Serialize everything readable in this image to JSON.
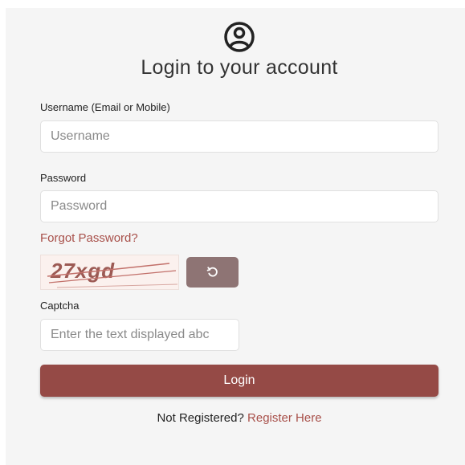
{
  "form": {
    "title": "Login to your account",
    "icon": "user-circle-icon",
    "username_label": "Username (Email or Mobile)",
    "username_placeholder": "Username",
    "username_value": "",
    "password_label": "Password",
    "password_placeholder": "Password",
    "password_value": "",
    "forgot_password": "Forgot Password?",
    "captcha_image_text": "27xgd",
    "refresh_icon": "refresh-icon",
    "captcha_label": "Captcha",
    "captcha_placeholder": "Enter the text displayed abc",
    "captcha_value": "",
    "login_button": "Login",
    "not_registered_text": "Not Registered?",
    "register_link": "Register Here"
  },
  "colors": {
    "accent": "#954a46",
    "link": "#a8504a",
    "refresh_button": "#8e7474",
    "panel_background": "#f5f5f5"
  }
}
